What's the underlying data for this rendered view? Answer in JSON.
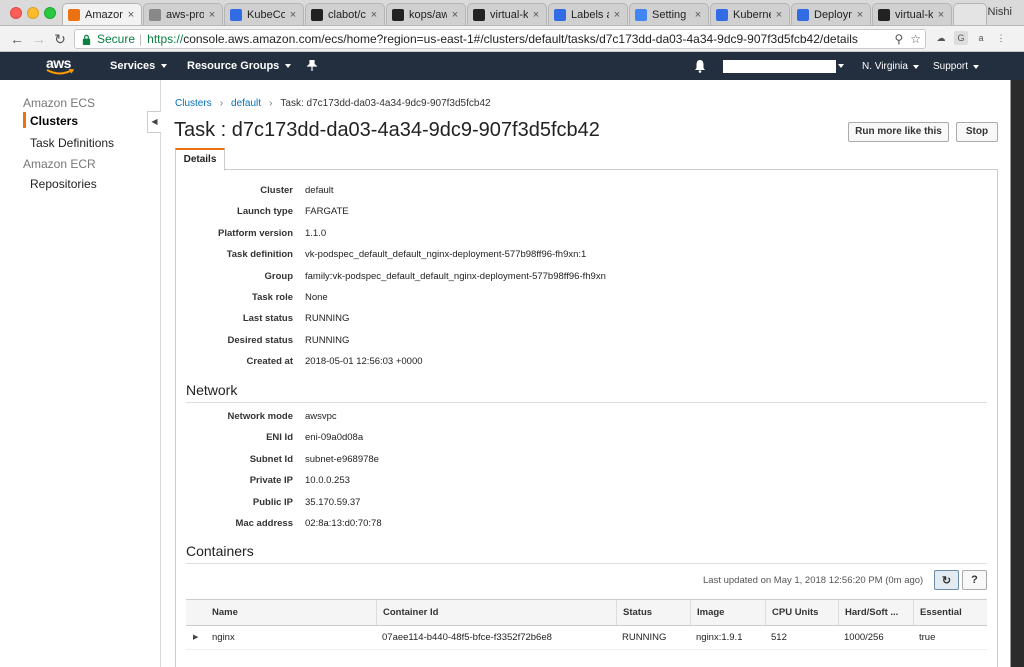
{
  "browser": {
    "tabs": [
      {
        "label": "Amazon ECS",
        "favicon": "aws-cube-icon",
        "color": "#ec7211",
        "active": true
      },
      {
        "label": "aws-project",
        "favicon": "document-icon",
        "color": "#888888",
        "active": false
      },
      {
        "label": "KubeCon",
        "favicon": "kubecon-icon",
        "color": "#326ce5",
        "active": false
      },
      {
        "label": "clabot/cla",
        "favicon": "github-icon",
        "color": "#222222",
        "active": false
      },
      {
        "label": "kops/aws",
        "favicon": "github-icon",
        "color": "#222222",
        "active": false
      },
      {
        "label": "virtual-ku",
        "favicon": "github-icon",
        "color": "#222222",
        "active": false
      },
      {
        "label": "Labels and",
        "favicon": "kubernetes-icon",
        "color": "#326ce5",
        "active": false
      },
      {
        "label": "Setting up",
        "favicon": "google-icon",
        "color": "#4285f4",
        "active": false
      },
      {
        "label": "Kubernetes",
        "favicon": "kubernetes-icon",
        "color": "#326ce5",
        "active": false
      },
      {
        "label": "Deployment",
        "favicon": "kubernetes-icon",
        "color": "#326ce5",
        "active": false
      },
      {
        "label": "virtual-ku",
        "favicon": "github-icon",
        "color": "#222222",
        "active": false
      }
    ],
    "profile": "Nishi",
    "secure_label": "Secure",
    "url_scheme": "https://",
    "url_rest": "console.aws.amazon.com/ecs/home?region=us-east-1#/clusters/default/tasks/d7c173dd-da03-4a34-9dc9-907f3d5fcb42/details"
  },
  "awsnav": {
    "logo": "aws",
    "services": "Services",
    "resource_groups": "Resource Groups",
    "region": "N. Virginia",
    "support": "Support"
  },
  "sidebar": {
    "section_ecs": "Amazon ECS",
    "clusters": "Clusters",
    "task_definitions": "Task Definitions",
    "section_ecr": "Amazon ECR",
    "repositories": "Repositories"
  },
  "breadcrumb": {
    "clusters": "Clusters",
    "default": "default",
    "current": "Task: d7c173dd-da03-4a34-9dc9-907f3d5fcb42"
  },
  "page": {
    "title": "Task : d7c173dd-da03-4a34-9dc9-907f3d5fcb42",
    "run_more": "Run more like this",
    "stop": "Stop",
    "details_tab": "Details"
  },
  "details": [
    {
      "key": "Cluster",
      "value": "default",
      "style": "link"
    },
    {
      "key": "Launch type",
      "value": "FARGATE",
      "style": "plain"
    },
    {
      "key": "Platform version",
      "value": "1.1.0",
      "style": "plain"
    },
    {
      "key": "Task definition",
      "value": "vk-podspec_default_default_nginx-deployment-577b98ff96-fh9xn:1",
      "style": "link"
    },
    {
      "key": "Group",
      "value": "family:vk-podspec_default_default_nginx-deployment-577b98ff96-fh9xn",
      "style": "plain"
    },
    {
      "key": "Task role",
      "value": "None",
      "style": "plain"
    },
    {
      "key": "Last status",
      "value": "RUNNING",
      "style": "green"
    },
    {
      "key": "Desired status",
      "value": "RUNNING",
      "style": "plain"
    },
    {
      "key": "Created at",
      "value": "2018-05-01 12:56:03 +0000",
      "style": "plain"
    }
  ],
  "network": {
    "heading": "Network",
    "rows": [
      {
        "key": "Network mode",
        "value": "awsvpc",
        "style": "plain"
      },
      {
        "key": "ENI Id",
        "value": "eni-09a0d08a",
        "style": "link"
      },
      {
        "key": "Subnet Id",
        "value": "subnet-e968978e",
        "style": "plain"
      },
      {
        "key": "Private IP",
        "value": "10.0.0.253",
        "style": "plain"
      },
      {
        "key": "Public IP",
        "value": "35.170.59.37",
        "style": "plain"
      },
      {
        "key": "Mac address",
        "value": "02:8a:13:d0:70:78",
        "style": "plain"
      }
    ]
  },
  "containers": {
    "heading": "Containers",
    "last_updated": "Last updated on May 1, 2018 12:56:20 PM (0m ago)",
    "columns": [
      "Name",
      "Container Id",
      "Status",
      "Image",
      "CPU Units",
      "Hard/Soft ...",
      "Essential"
    ],
    "rows": [
      {
        "cells": [
          "nginx",
          "07aee114-b440-48f5-bfce-f3352f72b6e8",
          "RUNNING",
          "nginx:1.9.1",
          "512",
          "1000/256",
          "true"
        ]
      }
    ]
  }
}
